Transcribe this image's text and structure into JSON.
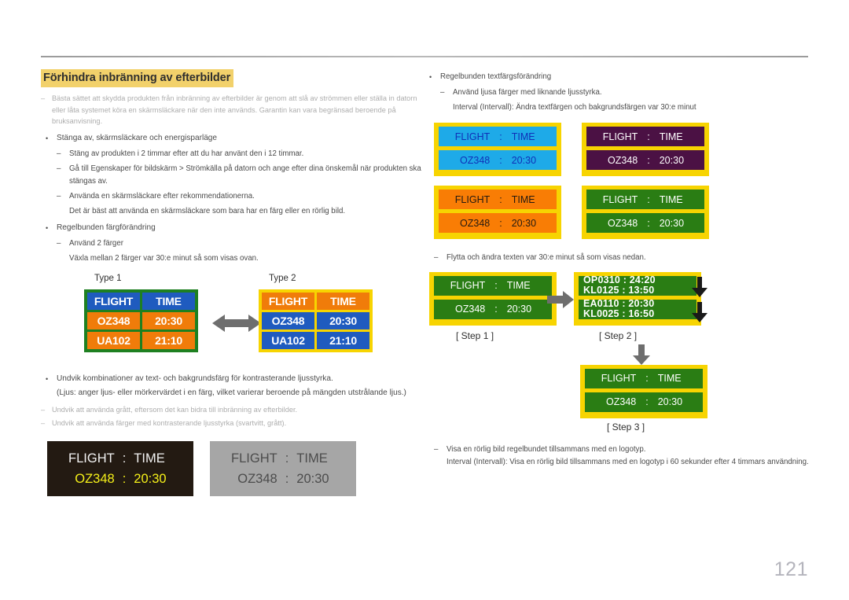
{
  "page": {
    "number": "121"
  },
  "left": {
    "title": "Förhindra inbränning av efterbilder",
    "intro_note": "Bästa sättet att skydda produkten från inbränning av efterbilder är genom att slå av strömmen eller ställa in datorn eller låta systemet köra en skärmsläckare när den inte används. Garantin kan vara begränsad beroende på bruksanvisning.",
    "bullet1": "Stänga av, skärmsläckare och energisparläge",
    "sub1_1": "Stäng av produkten i 2 timmar efter att du har använt den i 12 timmar.",
    "sub1_2": "Gå till Egenskaper för bildskärm > Strömkälla på datorn och ange efter dina önskemål när produkten ska stängas av.",
    "sub1_3": "Använda en skärmsläckare efter rekommendationerna.",
    "sub1_3_extra": "Det är bäst att använda en skärmsläckare som bara har en färg eller en rörlig bild.",
    "bullet2": "Regelbunden färgförändring",
    "sub2_1": "Använd 2 färger",
    "sub2_1_extra": "Växla mellan 2 färger var 30:e minut så som visas ovan.",
    "type1_label": "Type 1",
    "type2_label": "Type 2",
    "bullet3": "Undvik kombinationer av text- och bakgrundsfärg för kontrasterande ljusstyrka.",
    "bullet3_extra": "(Ljus: anger ljus- eller mörkervärdet i en färg, vilket varierar beroende på mängden utstrålande ljus.)",
    "note2": "Undvik att använda grått, eftersom det kan bidra till inbränning av efterbilder.",
    "note3": "Undvik att använda färger med kontrasterande ljusstyrka (svartvitt, grått)."
  },
  "right": {
    "bullet1": "Regelbunden textfärgsförändring",
    "sub1_1": "Använd ljusa färger med liknande ljusstyrka.",
    "sub1_1_extra": "Interval (Intervall): Ändra textfärgen och bakgrundsfärgen var 30:e minut",
    "sub2_1": "Flytta och ändra texten var 30:e minut så som visas nedan.",
    "step1_label": "[ Step 1 ]",
    "step2_label": "[ Step 2 ]",
    "step3_label": "[ Step 3 ]",
    "final1": "Visa en rörlig bild regelbundet tillsammans med en logotyp.",
    "final2": "Interval (Intervall): Visa en rörlig bild tillsammans med en logotyp i 60 sekunder efter 4 timmars användning."
  },
  "board_type1": {
    "cells": [
      "FLIGHT",
      "TIME",
      "OZ348",
      "20:30",
      "UA102",
      "21:10"
    ],
    "border_color": "#1e8021",
    "header_bg": "#1f5bbf",
    "row_bg": "#f07c0a"
  },
  "board_type2": {
    "cells": [
      "FLIGHT",
      "TIME",
      "OZ348",
      "20:30",
      "UA102",
      "21:10"
    ],
    "border_color": "#f7d401",
    "header_bg": "#f07c0a",
    "row_bg": "#1f5bbf"
  },
  "contrast_panels": [
    {
      "name": "dark",
      "bg": "#231a12",
      "row1": {
        "label": "FLIGHT",
        "sep": ":",
        "value": "TIME",
        "color": "#f2f2f2"
      },
      "row2": {
        "label": "OZ348",
        "sep": ":",
        "value": "20:30",
        "color": "#f5f019"
      }
    },
    {
      "name": "gray",
      "bg": "#a6a6a6",
      "row1": {
        "label": "FLIGHT",
        "sep": ":",
        "value": "TIME",
        "color": "#4c4c4c"
      },
      "row2": {
        "label": "OZ348",
        "sep": ":",
        "value": "20:30",
        "color": "#4c4c4c"
      }
    }
  ],
  "color_cards": [
    {
      "name": "cyan",
      "bg": "#1eaae8",
      "text": "#1030b8",
      "row1": [
        "FLIGHT",
        ":",
        "TIME"
      ],
      "row2": [
        "OZ348",
        ":",
        "20:30"
      ]
    },
    {
      "name": "purple",
      "bg": "#4b1144",
      "text": "#ffffff",
      "row1": [
        "FLIGHT",
        ":",
        "TIME"
      ],
      "row2": [
        "OZ348",
        ":",
        "20:30"
      ]
    },
    {
      "name": "orange",
      "bg": "#f97d05",
      "text": "#231a12",
      "row1": [
        "FLIGHT",
        ":",
        "TIME"
      ],
      "row2": [
        "OZ348",
        ":",
        "20:30"
      ]
    },
    {
      "name": "green",
      "bg": "#2a7d14",
      "text": "#ffffff",
      "row1": [
        "FLIGHT",
        ":",
        "TIME"
      ],
      "row2": [
        "OZ348",
        ":",
        "20:30"
      ]
    }
  ],
  "step1_card": {
    "row1": {
      "label": "FLIGHT",
      "sep": ":",
      "value": "TIME"
    },
    "row2": {
      "label": "OZ348",
      "sep": ":",
      "value": "20:30"
    }
  },
  "step2_card": {
    "bar1_top": "OP0310  :  24:20",
    "bar1_bottom": "KL0125  :  13:50",
    "bar2_top": "EA0110  :  20:30",
    "bar2_bottom": "KL0025  :  16:50"
  },
  "step3_card": {
    "row1": {
      "label": "FLIGHT",
      "sep": ":",
      "value": "TIME"
    },
    "row2": {
      "label": "OZ348",
      "sep": ":",
      "value": "20:30"
    }
  }
}
